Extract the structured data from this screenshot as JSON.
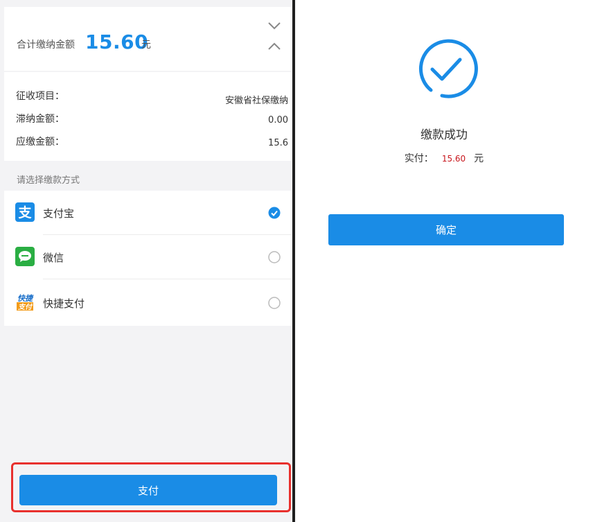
{
  "summary": {
    "label": "合计缴纳金额",
    "amount": "15.60",
    "unit": "元"
  },
  "details": {
    "item_label": "征收项目：",
    "item_value": "安徽省社保缴纳",
    "late_fee_label": "滞纳金额：",
    "late_fee_value": "0.00",
    "due_label": "应缴金额：",
    "due_value": "15.6"
  },
  "methods": {
    "title": "请选择缴款方式",
    "items": [
      {
        "label": "支付宝",
        "icon": "alipay-icon",
        "selected": true
      },
      {
        "label": "微信",
        "icon": "wechat-icon",
        "selected": false
      },
      {
        "label": "快捷支付",
        "icon": "quickpay-icon",
        "selected": false
      }
    ],
    "quickpay_icon_text_top": "快捷",
    "quickpay_icon_text_bottom": "支付"
  },
  "pay_button": "支付",
  "result": {
    "status": "缴款成功",
    "paid_label": "实付：",
    "paid_amount": "15.60",
    "paid_unit": "元",
    "confirm": "确定"
  },
  "colors": {
    "accent": "#1a8ce6",
    "highlight_border": "#e8302d",
    "amount_red": "#c8161d",
    "wechat_green": "#2aae43",
    "quickpay_orange": "#f39c1a"
  }
}
